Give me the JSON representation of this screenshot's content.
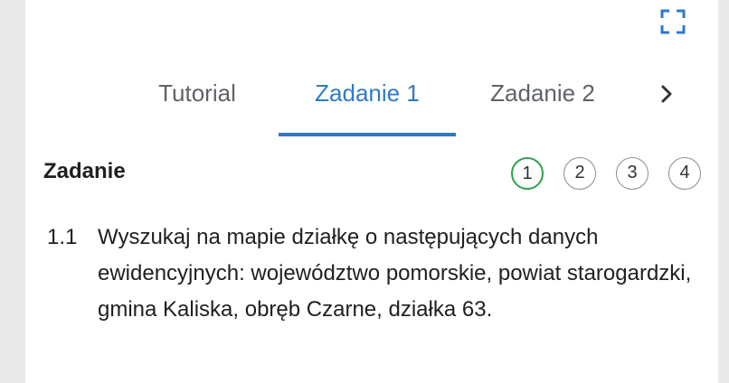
{
  "toolbar": {
    "fullscreen_icon": "fullscreen-corners-icon",
    "accent_color": "#2f7ac7"
  },
  "tabs": {
    "items": [
      {
        "label": "Tutorial",
        "active": false
      },
      {
        "label": "Zadanie 1",
        "active": true
      },
      {
        "label": "Zadanie 2",
        "active": false
      }
    ],
    "next_icon": "chevron-right-icon"
  },
  "section": {
    "title": "Zadanie",
    "steps": [
      {
        "label": "1",
        "active": true,
        "color": "#2ba24c"
      },
      {
        "label": "2",
        "active": false
      },
      {
        "label": "3",
        "active": false
      },
      {
        "label": "4",
        "active": false
      }
    ]
  },
  "task": {
    "number": "1.1",
    "text": "Wyszukaj na mapie działkę o następujących danych ewidencyjnych: województwo pomorskie, powiat starogardzki, gmina Kaliska, obręb Czarne, działka 63."
  }
}
